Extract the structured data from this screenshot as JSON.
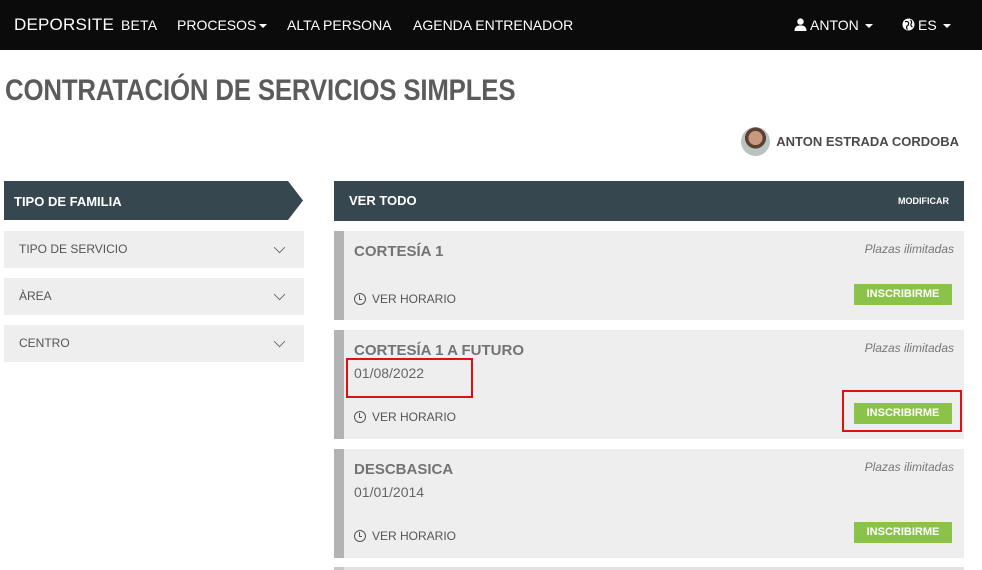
{
  "navbar": {
    "brand": "DEPORSITE",
    "brand_tag": "BETA",
    "items": [
      "PROCESOS",
      "ALTA PERSONA",
      "AGENDA ENTRENADOR"
    ],
    "user": "ANTON",
    "lang": "ES"
  },
  "page": {
    "title": "CONTRATACIÓN DE SERVICIOS SIMPLES",
    "user_name": "ANTON ESTRADA CORDOBA"
  },
  "sidebar": {
    "header": "TIPO DE FAMILIA",
    "filters": [
      "TIPO DE SERVICIO",
      "ÀREA",
      "CENTRO"
    ]
  },
  "main": {
    "header": "VER TODO",
    "modify": "MODIFICAR",
    "horario_label": "VER HORARIO",
    "button_label": "INSCRIBIRME",
    "places_label": "Plazas ilimitadas",
    "services": [
      {
        "name": "CORTESÍA 1",
        "date": ""
      },
      {
        "name": "CORTESÍA 1 A FUTURO",
        "date": "01/08/2022"
      },
      {
        "name": "DESCBASICA",
        "date": "01/01/2014"
      }
    ]
  },
  "colors": {
    "navbar": "#0b0b0b",
    "header": "#37474f",
    "button": "#8bc34a",
    "highlight": "#e01010"
  }
}
